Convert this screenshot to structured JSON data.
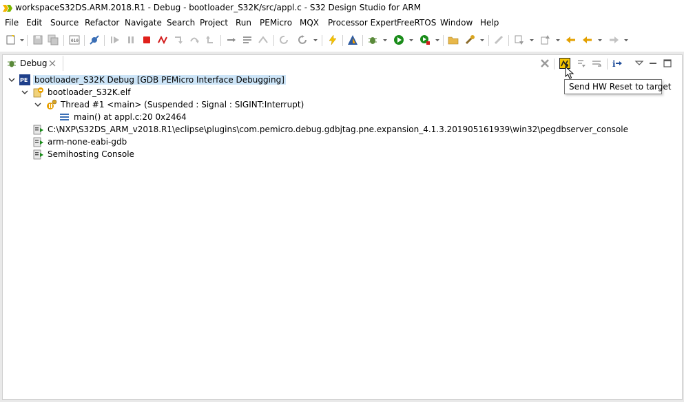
{
  "window": {
    "title": "workspaceS32DS.ARM.2018.R1 - Debug - bootloader_S32K/src/appl.c - S32 Design Studio for ARM"
  },
  "menu": {
    "items": [
      "File",
      "Edit",
      "Source",
      "Refactor",
      "Navigate",
      "Search",
      "Project",
      "Run",
      "PEMicro",
      "MQX",
      "Processor Expert",
      "FreeRTOS",
      "Window",
      "Help"
    ]
  },
  "debug_view": {
    "tab_label": "Debug",
    "tooltip": "Send HW Reset to target",
    "tree": [
      {
        "label": "bootloader_S32K Debug [GDB PEMicro Interface Debugging]",
        "icon": "pemicro-launch-icon",
        "selected": true
      },
      {
        "label": "bootloader_S32K.elf",
        "icon": "process-icon"
      },
      {
        "label": "Thread #1 <main> (Suspended : Signal : SIGINT:Interrupt)",
        "icon": "thread-suspended-icon"
      },
      {
        "label": "main() at appl.c:20 0x2464",
        "icon": "stack-frame-icon"
      },
      {
        "label": "C:\\NXP\\S32DS_ARM_v2018.R1\\eclipse\\plugins\\com.pemicro.debug.gdbjtag.pne.expansion_4.1.3.201905161939\\win32\\pegdbserver_console",
        "icon": "console-process-icon"
      },
      {
        "label": "arm-none-eabi-gdb",
        "icon": "console-process-icon"
      },
      {
        "label": "Semihosting Console",
        "icon": "console-process-icon"
      }
    ]
  },
  "colors": {
    "selection": "#cce4f7",
    "run_green": "#1a8c1a",
    "terminate_red": "#e0201b",
    "highlight_yellow": "#f5c400"
  }
}
